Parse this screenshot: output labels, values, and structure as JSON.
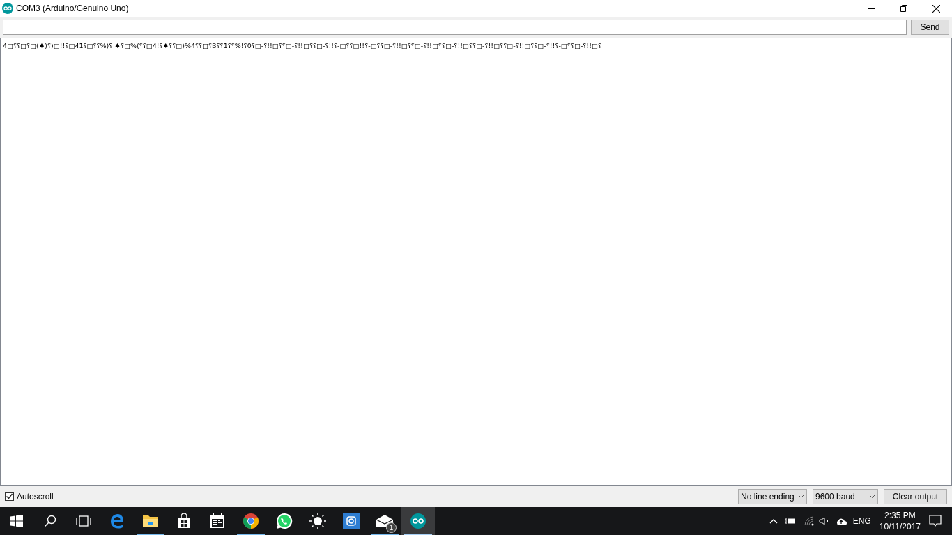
{
  "window": {
    "title": "COM3 (Arduino/Genuino Uno)"
  },
  "send_bar": {
    "button": "Send"
  },
  "output": {
    "text": "4□⸮⸮□⸮□(♠)⸮)□!!⸮□41⸮□⸮⸮%)⸮ ♠⸮□%(⸮⸮□4!⸮♠⸮⸮□)%4⸮⸮□⸮B⸮⸮1⸮⸮%!⸮0⸮□-⸮!!□⸮⸮□-⸮!!□⸮⸮□-⸮!!⸮-□⸮⸮□!!⸮-□⸮⸮□-⸮!!□⸮⸮□-⸮!!□⸮⸮□-⸮!!□⸮⸮□-⸮!!□⸮⸮□-⸮!!□⸮⸮□-⸮!!⸮-□⸮⸮□-⸮!!□⸮"
  },
  "bottom_bar": {
    "autoscroll": {
      "label": "Autoscroll",
      "checked": true
    },
    "line_ending": "No line ending",
    "baud": "9600 baud",
    "clear_button": "Clear output"
  },
  "taskbar": {
    "apps": [
      {
        "kind": "start",
        "running": false,
        "active": false
      },
      {
        "kind": "search",
        "running": false,
        "active": false
      },
      {
        "kind": "taskview",
        "running": false,
        "active": false
      },
      {
        "kind": "edge",
        "running": false,
        "active": false
      },
      {
        "kind": "explorer",
        "running": true,
        "active": false
      },
      {
        "kind": "store",
        "running": false,
        "active": false
      },
      {
        "kind": "calendar",
        "running": false,
        "active": false
      },
      {
        "kind": "chrome",
        "running": true,
        "active": false
      },
      {
        "kind": "whatsapp",
        "running": false,
        "active": false
      },
      {
        "kind": "sun",
        "running": false,
        "active": false
      },
      {
        "kind": "camera",
        "running": false,
        "active": false
      },
      {
        "kind": "mail",
        "running": true,
        "active": false,
        "badge": "1"
      },
      {
        "kind": "arduino",
        "running": true,
        "active": true
      }
    ],
    "tray": {
      "language": "ENG",
      "time": "2:35 PM",
      "date": "10/11/2017"
    }
  }
}
